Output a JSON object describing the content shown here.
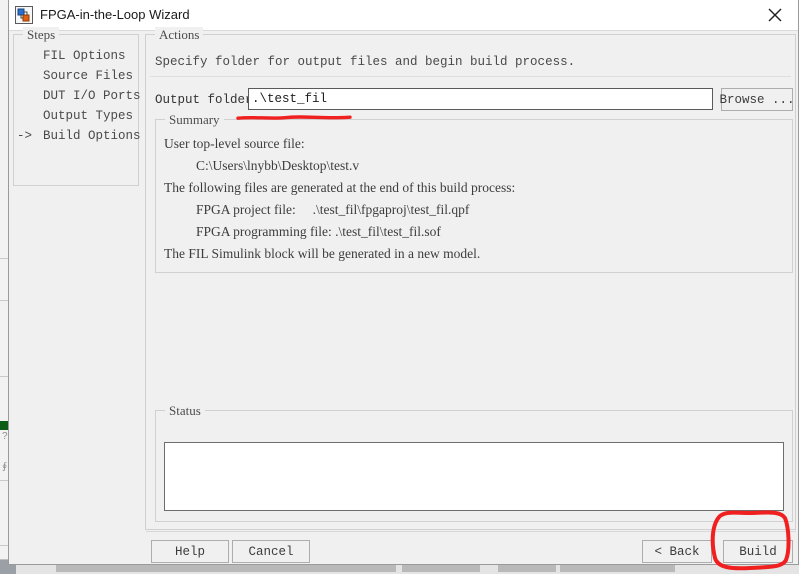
{
  "window": {
    "title": "FPGA-in-the-Loop Wizard",
    "icon": "simulink-block-icon",
    "close_icon": "close-icon"
  },
  "steps_panel": {
    "legend": "Steps",
    "items": [
      {
        "marker": "",
        "label": "FIL Options",
        "current": false
      },
      {
        "marker": "",
        "label": "Source Files",
        "current": false
      },
      {
        "marker": "",
        "label": "DUT I/O Ports",
        "current": false
      },
      {
        "marker": "",
        "label": "Output Types",
        "current": false
      },
      {
        "marker": "->",
        "label": "Build Options",
        "current": true
      }
    ]
  },
  "actions_panel": {
    "legend": "Actions",
    "description": "Specify folder for output files and begin build process.",
    "output_folder": {
      "label": "Output folder:",
      "value": ".\\test_fil",
      "placeholder": "",
      "browse_label": "Browse ..."
    }
  },
  "summary": {
    "legend": "Summary",
    "lines": [
      {
        "text": "User top-level source file:",
        "indent": false
      },
      {
        "text": "C:\\Users\\lnybb\\Desktop\\test.v",
        "indent": true
      },
      {
        "text": "The following files are generated at the end of this build process:",
        "indent": false
      },
      {
        "text": "FPGA project file:     .\\test_fil\\fpgaproj\\test_fil.qpf",
        "indent": true
      },
      {
        "text": "FPGA programming file: .\\test_fil\\test_fil.sof",
        "indent": true
      },
      {
        "text": "The FIL Simulink block will be generated in a new model.",
        "indent": false
      }
    ]
  },
  "status": {
    "legend": "Status",
    "value": "",
    "placeholder": ""
  },
  "footer": {
    "help_label": "Help",
    "cancel_label": "Cancel",
    "back_label": "< Back",
    "build_label": "Build"
  },
  "annotations": {
    "color": "#f02020",
    "underline_target": "output-folder-input",
    "circle_target": "build-button"
  }
}
